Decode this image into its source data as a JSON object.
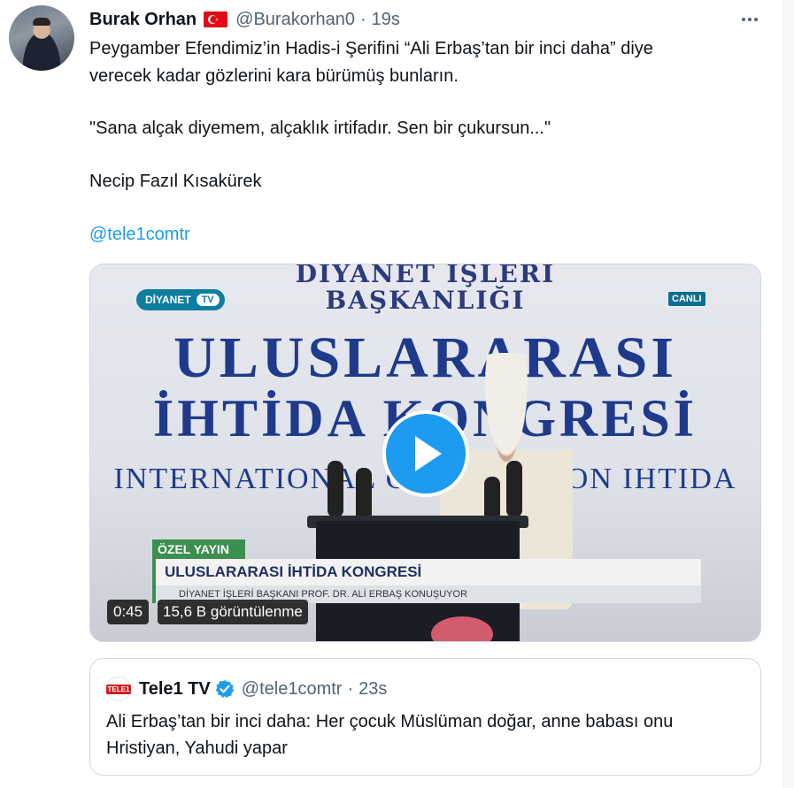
{
  "tweet": {
    "author_name": "Burak Orhan",
    "author_handle": "@Burakorhan0",
    "separator": "·",
    "time": "19s",
    "lines": [
      "Peygamber Efendimiz’in Hadis-i Şerifini “Ali Erbaş’tan bir inci daha” diye",
      "verecek kadar gözlerini kara bürümüş bunların.",
      "\"Sana alçak diyemem, alçaklık irtifadır. Sen bir çukursun...\"",
      "Necip Fazıl Kısakürek"
    ],
    "mention": "@tele1comtr"
  },
  "video": {
    "duration": "0:45",
    "views": "15,6 B görüntülenme",
    "frame": {
      "header1": "DİYANET İŞLERİ",
      "header2": "BAŞKANLIĞI",
      "big1": "ULUSLARARASI",
      "big2": "İHTİDA KONGRESİ",
      "intl": "INTERNATIONAL CONGRESS ON IHTIDA",
      "channel_logo": "DİYANET",
      "channel_tv": "TV",
      "live": "CANLI",
      "banner_tag": "ÖZEL YAYIN",
      "banner_main": "ULUSLARARASI İHTİDA KONGRESİ",
      "banner_sub": "DİYANET İŞLERİ BAŞKANI PROF. DR. ALİ ERBAŞ KONUŞUYOR"
    }
  },
  "quote": {
    "avatar_text": "TELE1",
    "name": "Tele1 TV",
    "handle": "@tele1comtr",
    "separator": "·",
    "time": "23s",
    "lines": [
      "Ali Erbaş’tan bir inci daha: Her çocuk Müslüman doğar, anne babası onu",
      "Hristiyan, Yahudi yapar"
    ]
  },
  "colors": {
    "accent": "#1d9bf0",
    "secondary_text": "#536471",
    "primary_text": "#0f1419",
    "border": "#cfd9de"
  },
  "icons": {
    "more": "more-horizontal-icon",
    "flag": "turkey-flag-icon",
    "verified": "verified-badge-icon",
    "play": "play-icon"
  }
}
